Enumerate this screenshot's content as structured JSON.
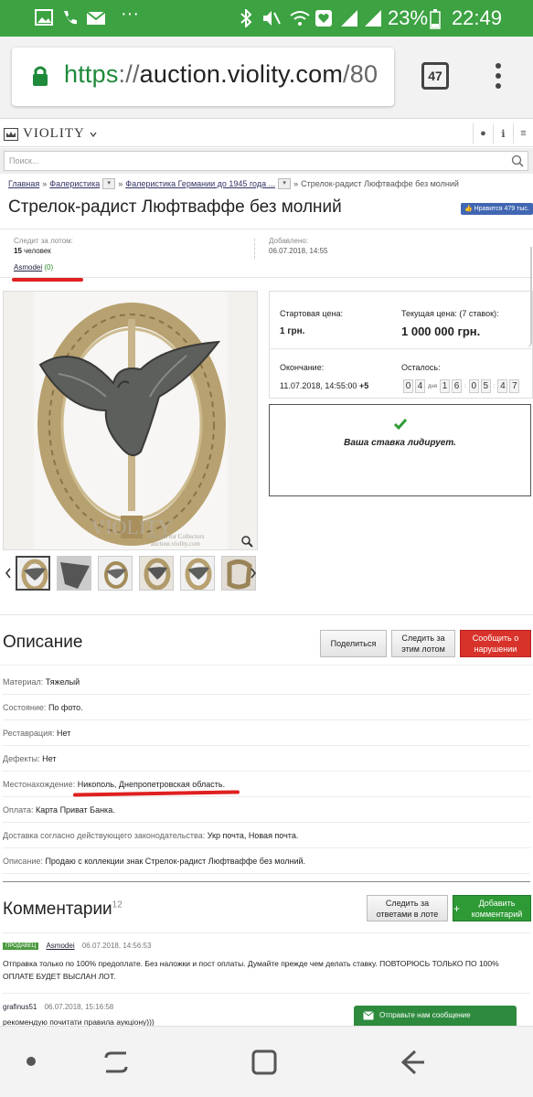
{
  "status_bar": {
    "battery_pct": "23%",
    "time": "22:49"
  },
  "browser": {
    "url_scheme": "https",
    "url_sep": "://",
    "url_host": "auction.violity.com",
    "url_rest": "/80",
    "tab_count": "47"
  },
  "site": {
    "logo": "VIOLITY",
    "search_placeholder": "Поиск..."
  },
  "breadcrumb": [
    "Главная",
    "Фалеристика",
    "Фалеристика Германии до 1945 года ...",
    "Стрелок-радист Люфтваффе без молний"
  ],
  "lot": {
    "title": "Стрелок-радист Люфтваффе без молний",
    "like_label": "Нравится",
    "like_count": "479 тыс.",
    "followers_label": "Следит за лотом:",
    "followers_count": "15",
    "followers_unit": "человек",
    "seller_name": "Asmodei",
    "seller_rating": "(0)",
    "added_label": "Добавлено:",
    "added_date": "06.07.2018, 14:55"
  },
  "price": {
    "start_label": "Стартовая цена:",
    "start_value": "1 грн.",
    "current_label": "Текущая цена: (7 ставок):",
    "current_value": "1 000 000 грн.",
    "end_label": "Окончание:",
    "end_value": "11.07.2018, 14:55:00",
    "end_tz": "+5",
    "left_label": "Осталось:",
    "days": [
      "0",
      "4"
    ],
    "days_label": "дня",
    "hours": [
      "1",
      "6"
    ],
    "minutes": [
      "0",
      "5"
    ],
    "seconds": [
      "4",
      "7"
    ],
    "lead_message": "Ваша ставка лидирует."
  },
  "image": {
    "watermark": "VIOLITY",
    "watermark_sub": "Auction for Collectors",
    "watermark_url": "auction.violity.com"
  },
  "description": {
    "title": "Описание",
    "share_btn": "Поделиться",
    "follow_btn": "Следить за этим лотом",
    "report_btn": "Сообщить о нарушении",
    "rows": [
      {
        "k": "Материал:",
        "v": "Тяжелый"
      },
      {
        "k": "Состояние:",
        "v": "По фото."
      },
      {
        "k": "Реставрация:",
        "v": "Нет"
      },
      {
        "k": "Дефекты:",
        "v": "Нет"
      },
      {
        "k": "Местонахождение:",
        "v": "Никополь, Днепропетровская область."
      },
      {
        "k": "Оплата:",
        "v": "Карта Приват Банка."
      },
      {
        "k": "Доставка согласно действующего законодательства:",
        "v": "Укр почта, Новая почта."
      },
      {
        "k": "Описание:",
        "v": "Продаю с коллекции знак Стрелок-радист Люфтваффе без молний."
      }
    ]
  },
  "comments": {
    "title": "Комментарии",
    "count": "12",
    "follow_btn": "Следить за ответами в лоте",
    "add_btn": "Добавить комментарий",
    "items": [
      {
        "badge": "ПРОДАВЕЦ",
        "author": "Asmodei",
        "date": "06.07.2018, 14:56:53",
        "text": "Отправка только по 100% предоплате. Без наложки и пост оплаты. Думайте прежде чем делать ставку. ПОВТОРЮСЬ ТОЛЬКО ПО 100% ОПЛАТЕ БУДЕТ ВЫСЛАН ЛОТ."
      },
      {
        "author": "grafinus51",
        "date": "06.07.2018, 15:16:58",
        "text": "рекомендую почитати правила аукціону)))"
      }
    ]
  },
  "chat_widget": "Отправьте нам сообщение"
}
